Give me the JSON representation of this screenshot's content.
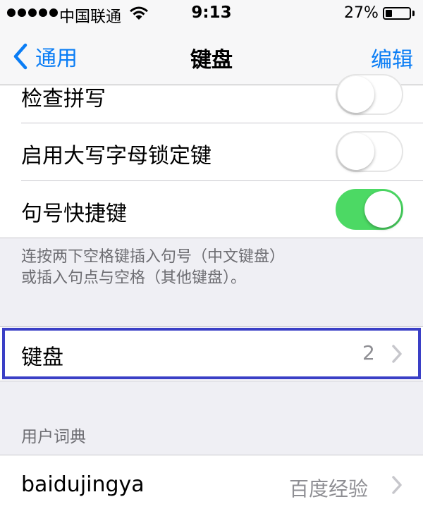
{
  "status_bar": {
    "carrier": "中国联通",
    "time": "9:13",
    "battery_percent": "27%",
    "battery_level": 0.27,
    "signal_bars": 5
  },
  "nav": {
    "back_label": "通用",
    "title": "键盘",
    "edit_label": "编辑"
  },
  "settings": {
    "spell_check": {
      "label": "检查拼写",
      "on": false
    },
    "caps_lock": {
      "label": "启用大写字母锁定键",
      "on": false
    },
    "period_shortcut": {
      "label": "句号快捷键",
      "on": true
    },
    "footnote_line1": "连按两下空格键插入句号（中文键盘）",
    "footnote_line2": "或插入句点与空格（其他键盘）。"
  },
  "keyboards": {
    "label": "键盘",
    "count": "2"
  },
  "dictionary": {
    "header": "用户词典",
    "entry": {
      "shortcut": "baidujingya",
      "phrase": "百度经验"
    }
  },
  "colors": {
    "ios_blue": "#0a7df5",
    "toggle_on": "#4cd964",
    "highlight_border": "#3a3fc6",
    "background": "#efeff4"
  }
}
